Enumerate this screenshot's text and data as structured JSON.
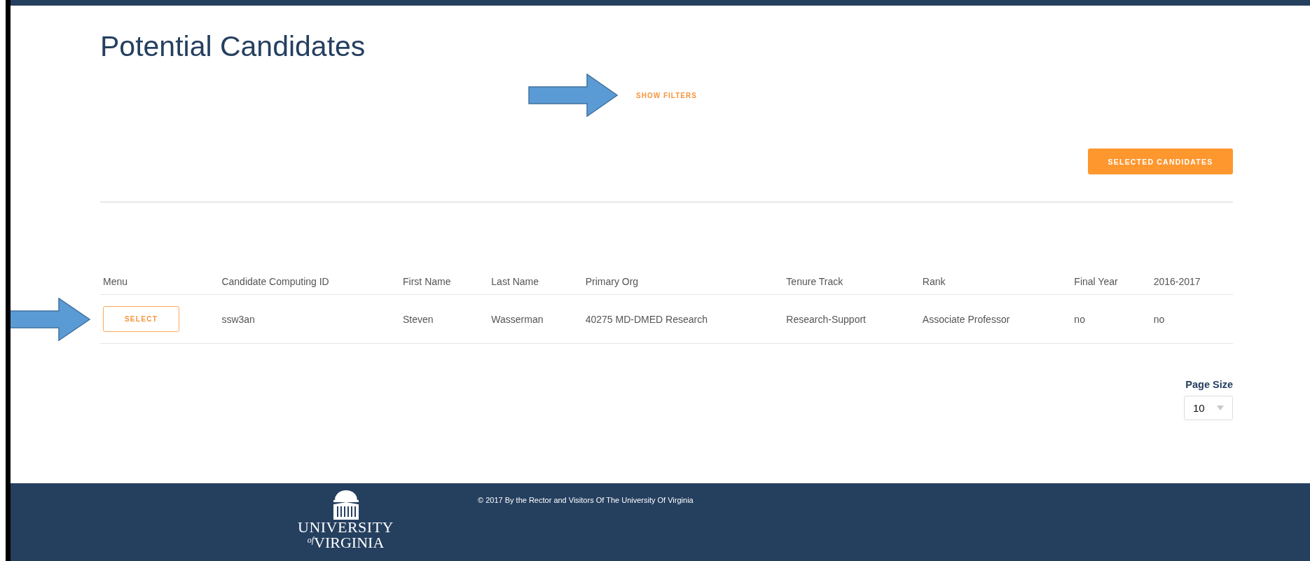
{
  "page": {
    "title": "Potential Candidates"
  },
  "filters_link": "SHOW FILTERS",
  "selected_button": "SELECTED CANDIDATES",
  "table": {
    "columns": [
      "Menu",
      "Candidate Computing ID",
      "First Name",
      "Last Name",
      "Primary Org",
      "Tenure Track",
      "Rank",
      "Final Year",
      "2016-2017"
    ],
    "rows": [
      {
        "cells": [
          "SELECT",
          "ssw3an",
          "Steven",
          "Wasserman",
          "40275 MD-DMED Research",
          "Research-Support",
          "Associate Professor",
          "no",
          "no"
        ]
      }
    ]
  },
  "page_size": {
    "label": "Page Size",
    "value": "10"
  },
  "footer": {
    "logo": {
      "line1": "UNIVERSITY",
      "of": "of",
      "line2": "VIRGINIA"
    },
    "copyright": "© 2017 By the Rector and Visitors Of The University Of Virginia"
  }
}
